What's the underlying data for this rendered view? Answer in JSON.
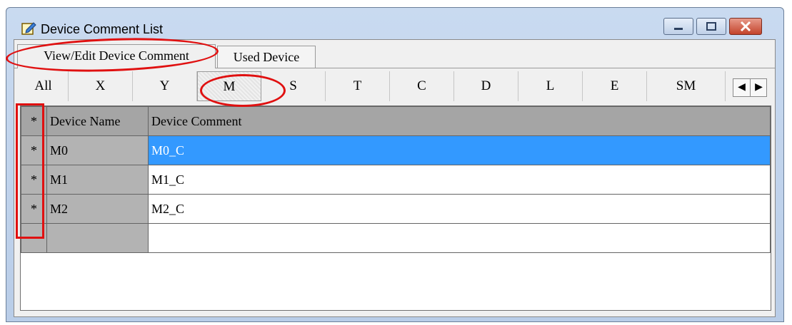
{
  "window": {
    "title": "Device Comment List"
  },
  "tabs": [
    {
      "label": "View/Edit Device Comment",
      "active": true
    },
    {
      "label": "Used Device",
      "active": false
    }
  ],
  "filters": [
    {
      "label": "All"
    },
    {
      "label": "X"
    },
    {
      "label": "Y"
    },
    {
      "label": "M",
      "selected": true
    },
    {
      "label": "S"
    },
    {
      "label": "T"
    },
    {
      "label": "C"
    },
    {
      "label": "D"
    },
    {
      "label": "L"
    },
    {
      "label": "E"
    },
    {
      "label": "SM"
    }
  ],
  "table": {
    "headers": {
      "marker": "*",
      "name": "Device Name",
      "comment": "Device Comment"
    },
    "rows": [
      {
        "marker": "*",
        "name": "M0",
        "comment": "M0_C",
        "selected": true
      },
      {
        "marker": "*",
        "name": "M1",
        "comment": "M1_C"
      },
      {
        "marker": "*",
        "name": "M2",
        "comment": "M2_C"
      },
      {
        "marker": "",
        "name": "",
        "comment": ""
      }
    ]
  },
  "icons": {
    "title": "edit-pencil-icon",
    "minimize": "minimize-icon",
    "maximize": "maximize-icon",
    "close": "close-icon",
    "scroll_left": "arrow-left-icon",
    "scroll_right": "arrow-right-icon"
  },
  "colors": {
    "selection": "#3399ff",
    "annotation": "#e01010",
    "header_gray": "#a5a5a5"
  }
}
